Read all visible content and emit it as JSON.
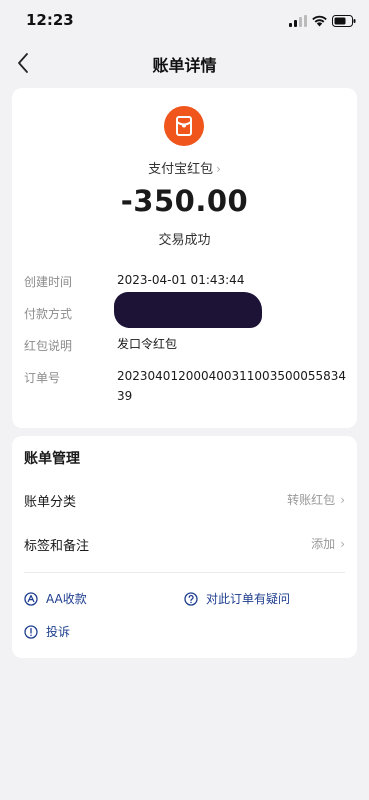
{
  "status_bar": {
    "time": "12:23"
  },
  "nav": {
    "title": "账单详情"
  },
  "detail": {
    "merchant": "支付宝红包",
    "amount": "-350.00",
    "status": "交易成功",
    "rows": [
      {
        "label": "创建时间",
        "value": "2023-04-01 01:43:44"
      },
      {
        "label": "付款方式",
        "value": ""
      },
      {
        "label": "红包说明",
        "value": "发口令红包"
      },
      {
        "label": "订单号",
        "value": "20230401200040031100350005583439"
      }
    ]
  },
  "manage": {
    "title": "账单管理",
    "category_label": "账单分类",
    "category_value": "转账红包",
    "tag_label": "标签和备注",
    "tag_value": "添加",
    "actions": {
      "aa": "AA收款",
      "question": "对此订单有疑问",
      "complain": "投诉"
    }
  },
  "colors": {
    "accent_orange": "#f0551c",
    "link_blue": "#1d3d8f",
    "background": "#f2f2f5"
  }
}
